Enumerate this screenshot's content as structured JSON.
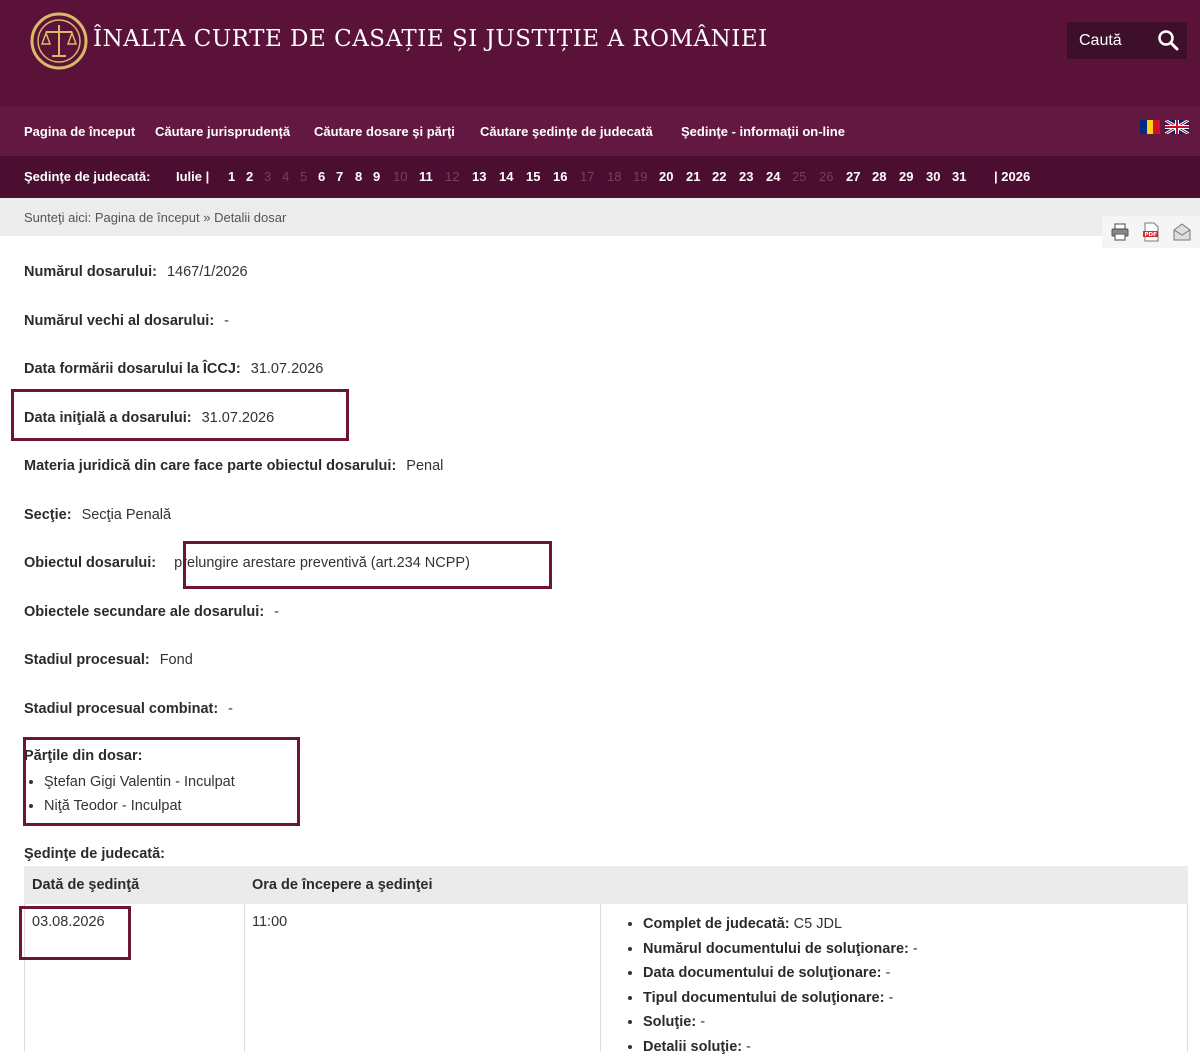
{
  "header": {
    "title": "ÎNALTA CURTE DE CASAȚIE ȘI JUSTIȚIE A ROMÂNIEI",
    "search_label": "Caută"
  },
  "nav": {
    "items": [
      "Pagina de început",
      "Căutare jurisprudență",
      "Căutare dosare şi părţi",
      "Căutare şedinţe de judecată",
      "Şedinţe - informaţii on-line"
    ]
  },
  "days_bar": {
    "label": "Şedinţe de judecată:",
    "month": "Iulie |",
    "days": [
      {
        "n": "1",
        "a": true
      },
      {
        "n": "2",
        "a": true
      },
      {
        "n": "3",
        "a": false
      },
      {
        "n": "4",
        "a": false
      },
      {
        "n": "5",
        "a": false
      },
      {
        "n": "6",
        "a": true
      },
      {
        "n": "7",
        "a": true
      },
      {
        "n": "8",
        "a": true
      },
      {
        "n": "9",
        "a": true
      },
      {
        "n": "10",
        "a": false
      },
      {
        "n": "11",
        "a": true
      },
      {
        "n": "12",
        "a": false
      },
      {
        "n": "13",
        "a": true
      },
      {
        "n": "14",
        "a": true
      },
      {
        "n": "15",
        "a": true
      },
      {
        "n": "16",
        "a": true
      },
      {
        "n": "17",
        "a": false
      },
      {
        "n": "18",
        "a": false
      },
      {
        "n": "19",
        "a": false
      },
      {
        "n": "20",
        "a": true
      },
      {
        "n": "21",
        "a": true
      },
      {
        "n": "22",
        "a": true
      },
      {
        "n": "23",
        "a": true
      },
      {
        "n": "24",
        "a": true
      },
      {
        "n": "25",
        "a": false
      },
      {
        "n": "26",
        "a": false
      },
      {
        "n": "27",
        "a": true
      },
      {
        "n": "28",
        "a": true
      },
      {
        "n": "29",
        "a": true
      },
      {
        "n": "30",
        "a": true
      },
      {
        "n": "31",
        "a": true
      }
    ],
    "year": "| 2026"
  },
  "breadcrumb": "Sunteţi aici: Pagina de început » Detalii dosar",
  "fields": {
    "numar": {
      "k": "Numărul dosarului:",
      "v": "1467/1/2026"
    },
    "numar_vechi": {
      "k": "Numărul vechi al dosarului:",
      "v": "-"
    },
    "data_formarii": {
      "k": "Data formării dosarului la ÎCCJ:",
      "v": "31.07.2026"
    },
    "data_initiala": {
      "k": "Data iniţială a dosarului:",
      "v": "31.07.2026"
    },
    "materia": {
      "k": "Materia juridică din care face parte obiectul dosarului:",
      "v": "Penal"
    },
    "sectie": {
      "k": "Secţie:",
      "v": "Secţia Penală"
    },
    "obiect": {
      "k": "Obiectul dosarului:",
      "v": "prelungire arestare preventivă (art.234 NCPP)"
    },
    "obiecte_secundare": {
      "k": "Obiectele secundare ale dosarului:",
      "v": "-"
    },
    "stadiu": {
      "k": "Stadiul procesual:",
      "v": "Fond"
    },
    "stadiu_combinat": {
      "k": "Stadiul procesual combinat:",
      "v": "-"
    }
  },
  "parties": {
    "title": "Părţile din dosar:",
    "items": [
      "Ştefan Gigi Valentin - Inculpat",
      "Niţă Teodor - Inculpat"
    ]
  },
  "sedinte": {
    "title": "Şedinţe de judecată:",
    "col_date": "Dată de şedinţă",
    "col_time": "Ora de începere a şedinţei",
    "row": {
      "date": "03.08.2026",
      "time": "11:00",
      "details": [
        {
          "k": "Complet de judecată:",
          "v": "C5 JDL"
        },
        {
          "k": "Numărul documentului de soluţionare:",
          "v": "-"
        },
        {
          "k": "Data documentului de soluţionare:",
          "v": "-"
        },
        {
          "k": "Tipul documentului de soluţionare:",
          "v": "-"
        },
        {
          "k": "Soluţie:",
          "v": "-"
        },
        {
          "k": "Detalii soluţie:",
          "v": "-"
        }
      ]
    }
  }
}
